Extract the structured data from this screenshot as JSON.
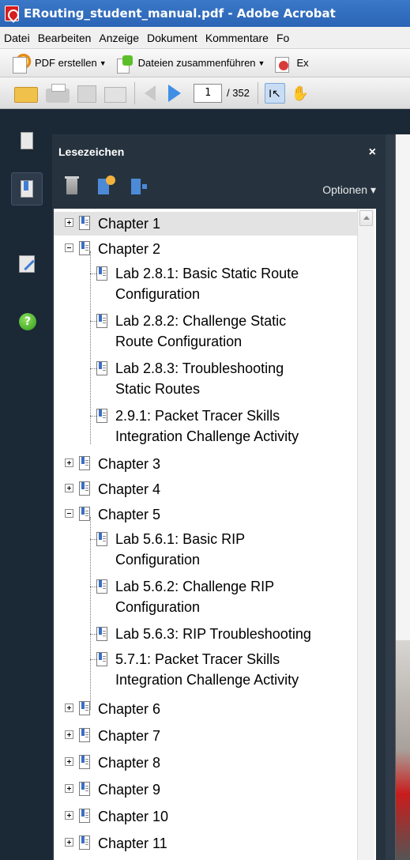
{
  "window": {
    "title": "ERouting_student_manual.pdf - Adobe Acrobat"
  },
  "menubar": [
    "Datei",
    "Bearbeiten",
    "Anzeige",
    "Dokument",
    "Kommentare",
    "Fo"
  ],
  "toolbar1": {
    "create_pdf": "PDF erstellen",
    "merge_files": "Dateien zusammenführen",
    "export": "Ex"
  },
  "toolbar2": {
    "page_current": "1",
    "page_total": "/ 352"
  },
  "panel": {
    "title": "Lesezeichen",
    "close": "×",
    "options": "Optionen ▾"
  },
  "bookmarks": [
    {
      "label": "Chapter 1",
      "expanded": false
    },
    {
      "label": "Chapter 2",
      "expanded": true,
      "children": [
        {
          "line1": "Lab 2.8.1: Basic Static Route",
          "line2": "Configuration"
        },
        {
          "line1": "Lab 2.8.2: Challenge Static",
          "line2": "Route Configuration"
        },
        {
          "line1": "Lab 2.8.3: Troubleshooting",
          "line2": "Static Routes"
        },
        {
          "line1": "2.9.1: Packet Tracer Skills",
          "line2": "Integration Challenge Activity"
        }
      ]
    },
    {
      "label": "Chapter 3",
      "expanded": false
    },
    {
      "label": "Chapter 4",
      "expanded": false
    },
    {
      "label": "Chapter 5",
      "expanded": true,
      "children": [
        {
          "line1": "Lab 5.6.1: Basic RIP",
          "line2": "Configuration"
        },
        {
          "line1": "Lab 5.6.2: Challenge RIP",
          "line2": "Configuration"
        },
        {
          "line1": "Lab 5.6.3: RIP Troubleshooting",
          "line2": ""
        },
        {
          "line1": "5.7.1: Packet Tracer Skills",
          "line2": "Integration Challenge Activity"
        }
      ]
    },
    {
      "label": "Chapter 6",
      "expanded": false
    },
    {
      "label": "Chapter 7",
      "expanded": false
    },
    {
      "label": "Chapter 8",
      "expanded": false
    },
    {
      "label": "Chapter 9",
      "expanded": false
    },
    {
      "label": "Chapter 10",
      "expanded": false
    },
    {
      "label": "Chapter 11",
      "expanded": false
    }
  ],
  "icons": {
    "nav": [
      "pages-icon",
      "bookmarks-icon",
      "signature-icon",
      "help-icon"
    ],
    "panel_tools": [
      "trash-icon",
      "new-bookmark-icon",
      "expand-bookmark-icon"
    ]
  },
  "colors": {
    "titlebar": "#2a64b6",
    "panel_bg": "#26333f",
    "nav_bg": "#1b2836",
    "selected_row": "#e3e3e3"
  }
}
